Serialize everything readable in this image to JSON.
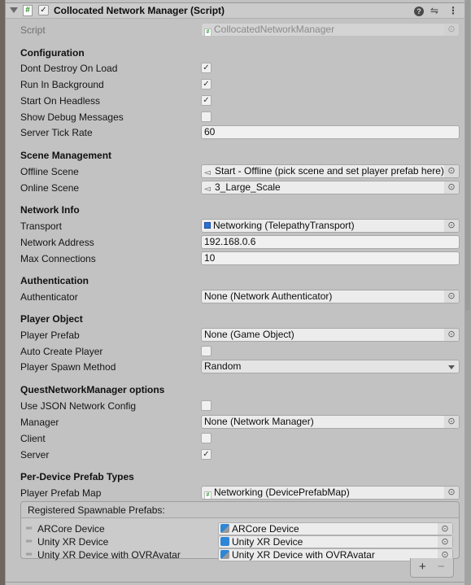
{
  "component": {
    "title": "Collocated Network Manager (Script)",
    "enabled": true,
    "icons": {
      "foldout": "triangle-down-icon",
      "script": "csharp-script-icon",
      "help": "help-icon",
      "presets": "preset-sliders-icon",
      "menu": "kebab-menu-icon"
    }
  },
  "script_field": {
    "label": "Script",
    "value": "CollocatedNetworkManager"
  },
  "sections": {
    "configuration": {
      "title": "Configuration",
      "dont_destroy_on_load": {
        "label": "Dont Destroy On Load",
        "checked": true
      },
      "run_in_background": {
        "label": "Run In Background",
        "checked": true
      },
      "start_on_headless": {
        "label": "Start On Headless",
        "checked": true
      },
      "show_debug_messages": {
        "label": "Show Debug Messages",
        "checked": false
      },
      "server_tick_rate": {
        "label": "Server Tick Rate",
        "value": "60"
      }
    },
    "scene_management": {
      "title": "Scene Management",
      "offline_scene": {
        "label": "Offline Scene",
        "value": "Start - Offline (pick scene and set player prefab here)"
      },
      "online_scene": {
        "label": "Online Scene",
        "value": "3_Large_Scale"
      }
    },
    "network_info": {
      "title": "Network Info",
      "transport": {
        "label": "Transport",
        "value": "Networking (TelepathyTransport)"
      },
      "network_address": {
        "label": "Network Address",
        "value": "192.168.0.6"
      },
      "max_connections": {
        "label": "Max Connections",
        "value": "10"
      }
    },
    "authentication": {
      "title": "Authentication",
      "authenticator": {
        "label": "Authenticator",
        "value": "None (Network Authenticator)"
      }
    },
    "player_object": {
      "title": "Player Object",
      "player_prefab": {
        "label": "Player Prefab",
        "value": "None (Game Object)"
      },
      "auto_create_player": {
        "label": "Auto Create Player",
        "checked": false
      },
      "player_spawn_method": {
        "label": "Player Spawn Method",
        "value": "Random"
      }
    },
    "quest_options": {
      "title": "QuestNetworkManager options",
      "use_json_config": {
        "label": "Use JSON Network Config",
        "checked": false
      },
      "manager": {
        "label": "Manager",
        "value": "None (Network Manager)"
      },
      "client": {
        "label": "Client",
        "checked": false
      },
      "server": {
        "label": "Server",
        "checked": true
      }
    },
    "per_device": {
      "title": "Per-Device Prefab Types",
      "player_prefab_map": {
        "label": "Player Prefab Map",
        "value": "Networking (DevicePrefabMap)"
      }
    }
  },
  "spawnable_prefabs": {
    "header": "Registered Spawnable Prefabs:",
    "items": [
      {
        "label": "ARCore Device",
        "value": "ARCore Device",
        "icon": "prefab-variant-icon"
      },
      {
        "label": "Unity XR Device",
        "value": "Unity XR Device",
        "icon": "prefab-icon"
      },
      {
        "label": "Unity XR Device with OVRAvatar",
        "value": "Unity XR Device with OVRAvatar",
        "icon": "prefab-variant-icon"
      }
    ],
    "add_label": "+",
    "remove_label": "−"
  },
  "glyphs": {
    "check": "✓",
    "picker": "⊙",
    "drag": "═",
    "help": "?",
    "presets": "⇋",
    "menu": "⋮",
    "hash": "#",
    "scene": "◅"
  }
}
